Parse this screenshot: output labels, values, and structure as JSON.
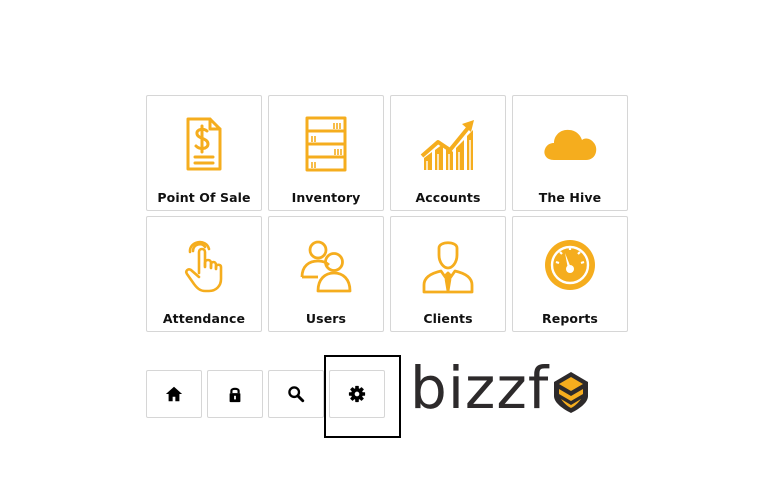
{
  "tiles": [
    {
      "label": "Point Of Sale",
      "icon": "receipt-dollar-icon"
    },
    {
      "label": "Inventory",
      "icon": "shelves-icon"
    },
    {
      "label": "Accounts",
      "icon": "growth-chart-icon"
    },
    {
      "label": "The Hive",
      "icon": "cloud-icon"
    },
    {
      "label": "Attendance",
      "icon": "hand-touch-icon"
    },
    {
      "label": "Users",
      "icon": "users-icon"
    },
    {
      "label": "Clients",
      "icon": "client-icon"
    },
    {
      "label": "Reports",
      "icon": "gauge-icon"
    }
  ],
  "toolbar": [
    {
      "icon": "home-icon"
    },
    {
      "icon": "lock-icon"
    },
    {
      "icon": "search-icon"
    },
    {
      "icon": "gear-icon"
    }
  ],
  "logo": {
    "text": "bizzf",
    "icon": "bee-hive-icon"
  },
  "colors": {
    "accent": "#F5AD1E",
    "text": "#111111",
    "logo_text": "#2D2A2B",
    "border": "#D6D6D6"
  }
}
